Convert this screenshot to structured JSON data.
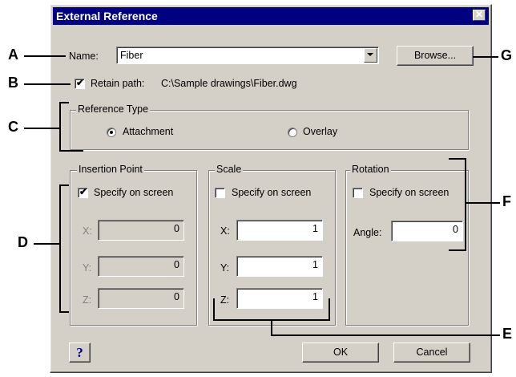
{
  "window": {
    "title": "External Reference",
    "close_glyph": "✕"
  },
  "name_row": {
    "label": "Name:",
    "value": "Fiber",
    "browse_label": "Browse..."
  },
  "retain_path": {
    "label": "Retain path:",
    "path": "C:\\Sample drawings\\Fiber.dwg",
    "checked": true
  },
  "reference_type": {
    "title": "Reference Type",
    "attachment": "Attachment",
    "overlay": "Overlay",
    "selected": "Attachment"
  },
  "insertion_point": {
    "title": "Insertion Point",
    "specify_label": "Specify on screen",
    "specify_checked": true,
    "x_label": "X:",
    "x": "0",
    "y_label": "Y:",
    "y": "0",
    "z_label": "Z:",
    "z": "0"
  },
  "scale": {
    "title": "Scale",
    "specify_label": "Specify on screen",
    "specify_checked": false,
    "x_label": "X:",
    "x": "1",
    "y_label": "Y:",
    "y": "1",
    "z_label": "Z:",
    "z": "1"
  },
  "rotation": {
    "title": "Rotation",
    "specify_label": "Specify on screen",
    "specify_checked": false,
    "angle_label": "Angle:",
    "angle": "0"
  },
  "buttons": {
    "help": "?",
    "ok": "OK",
    "cancel": "Cancel"
  },
  "callouts": {
    "a": "A",
    "b": "B",
    "c": "C",
    "d": "D",
    "e": "E",
    "f": "F",
    "g": "G"
  }
}
